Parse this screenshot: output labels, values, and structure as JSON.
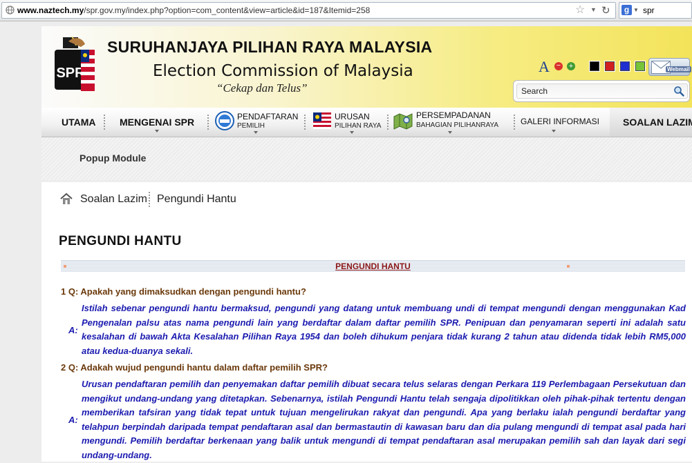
{
  "browser": {
    "url_domain": "www.naztech.my",
    "url_path": "/spr.gov.my/index.php?option=com_content&view=article&id=187&Itemid=258",
    "search_query": "spr"
  },
  "header": {
    "logo_text": "SPR",
    "title_malay": "SURUHANJAYA PILIHAN RAYA MALAYSIA",
    "title_english": "Election Commission of Malaysia",
    "tagline": "“Cekap dan Telus”",
    "font_size_label": "A",
    "webmail_label": "Webmail",
    "search_placeholder": "Search",
    "swatch_colors": [
      "#000000",
      "#d12020",
      "#1f2fd0",
      "#77c33a"
    ]
  },
  "nav": {
    "items": [
      {
        "label": "UTAMA"
      },
      {
        "label": "MENGENAI SPR"
      },
      {
        "top": "PENDAFTARAN",
        "sub": "PEMILIH"
      },
      {
        "top": "URUSAN",
        "sub": "PILIHAN RAYA"
      },
      {
        "top": "PERSEMPADANAN",
        "sub": "BAHAGIAN PILIHANRAYA"
      },
      {
        "label": "GALERI INFORMASI"
      },
      {
        "label": "SOALAN LAZIM"
      }
    ]
  },
  "popup": {
    "title": "Popup Module"
  },
  "breadcrumb": [
    "Soalan Lazim",
    "Pengundi Hantu"
  ],
  "article": {
    "title": "PENGUNDI HANTU",
    "section_title": "PENGUNDI HANTU",
    "answer_marker": "A:",
    "qa": [
      {
        "question": "1 Q: Apakah yang dimaksudkan dengan pengundi hantu?",
        "answer": "Istilah sebenar pengundi hantu bermaksud, pengundi yang datang untuk membuang undi di tempat mengundi dengan menggunakan Kad Pengenalan palsu atas nama pengundi lain yang berdaftar dalam daftar pemilih SPR. Penipuan dan penyamaran seperti ini adalah satu kesalahan di bawah Akta Kesalahan Pilihan Raya 1954 dan boleh dihukum penjara tidak kurang 2 tahun atau didenda tidak lebih RM5,000 atau kedua-duanya sekali."
      },
      {
        "question": "2 Q: Adakah wujud pengundi hantu dalam daftar pemilih SPR?",
        "answer": "Urusan pendaftaran pemilih dan penyemakan daftar pemilih dibuat secara telus selaras dengan Perkara 119 Perlembagaan Persekutuan dan mengikut undang-undang yang ditetapkan. Sebenarnya, istilah Pengundi Hantu telah sengaja dipolitikkan oleh pihak-pihak tertentu dengan memberikan tafsiran yang tidak tepat untuk tujuan mengelirukan rakyat dan pengundi. Apa yang berlaku ialah pengundi berdaftar yang telahpun berpindah daripada tempat pendaftaran asal dan bermastautin di kawasan baru dan dia pulang mengundi di tempat asal pada hari mengundi. Pemilih berdaftar berkenaan yang balik untuk mengundi di tempat pendaftaran asal merupakan pemilih sah dan layak dari segi undang-undang."
      }
    ]
  }
}
